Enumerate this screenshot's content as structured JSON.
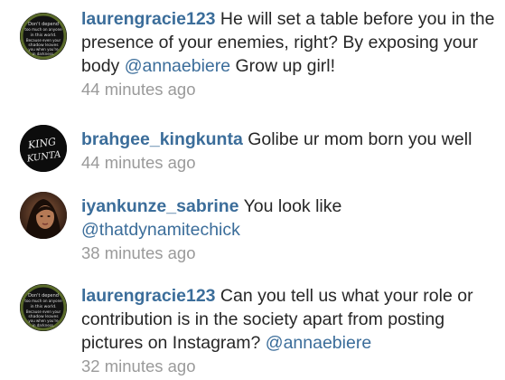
{
  "comments": [
    {
      "username": "laurengracie123",
      "text_before": " He will set a table before you in the presence of your enemies, right? By exposing your body ",
      "mention": "@annaebiere",
      "text_after": " Grow up girl!",
      "time": "44 minutes ago",
      "avatar_text": [
        "Don't depend",
        "too much on anyone",
        "in this world.",
        "Because even your",
        "shadow leaves",
        "you when you're",
        "in darkness."
      ]
    },
    {
      "username": "brahgee_kingkunta",
      "text_before": " Golibe ur mom born you well",
      "mention": "",
      "text_after": "",
      "time": "44 minutes ago",
      "avatar_text": [
        "KING",
        "KUNTA"
      ]
    },
    {
      "username": "iyankunze_sabrine",
      "text_before": " You look like ",
      "mention": "@thatdynamitechick",
      "text_after": "",
      "time": "38 minutes ago"
    },
    {
      "username": "laurengracie123",
      "text_before": " Can you tell us what your role or contribution is in the society apart from posting pictures on Instagram? ",
      "mention": "@annaebiere",
      "text_after": "",
      "time": "32 minutes ago",
      "avatar_text": [
        "Don't depend",
        "too much on anyone",
        "in this world.",
        "Because even your",
        "shadow leaves",
        "you when you're",
        "in darkness."
      ]
    }
  ]
}
